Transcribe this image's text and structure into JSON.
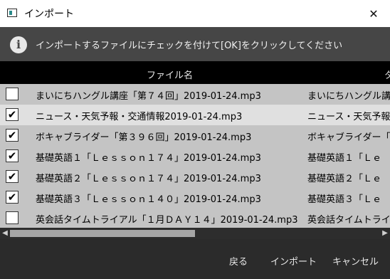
{
  "window": {
    "title": "インポート",
    "close": "✕"
  },
  "info": {
    "icon": "i",
    "message": "インポートするファイルにチェックを付けて[OK]をクリックしてください"
  },
  "table": {
    "headers": [
      "ファイル名",
      "タ"
    ],
    "rows": [
      {
        "checked": false,
        "file": "まいにちハングル講座「第７４回」2019-01-24.mp3",
        "title": "まいにちハングル講座"
      },
      {
        "checked": true,
        "file": "ニュース・天気予報・交通情報2019-01-24.mp3",
        "title": "ニュース・天気予報・"
      },
      {
        "checked": true,
        "file": "ボキャブライダー「第３９６回」2019-01-24.mp3",
        "title": "ボキャブライダー「第"
      },
      {
        "checked": true,
        "file": "基礎英語１「Ｌｅｓｓｏｎ１７４」2019-01-24.mp3",
        "title": "基礎英語１「Ｌｅ"
      },
      {
        "checked": true,
        "file": "基礎英語２「Ｌｅｓｓｏｎ１７４」2019-01-24.mp3",
        "title": "基礎英語２「Ｌｅ"
      },
      {
        "checked": true,
        "file": "基礎英語３「Ｌｅｓｓｏｎ１４０」2019-01-24.mp3",
        "title": "基礎英語３「Ｌｅ"
      },
      {
        "checked": false,
        "file": "英会話タイムトライアル「１月ＤＡＹ１４」2019-01-24.mp3",
        "title": "英会話タイムトライア"
      }
    ],
    "selected_row": 1
  },
  "buttons": {
    "back": "戻る",
    "import": "インポート",
    "cancel": "キャンセル"
  }
}
